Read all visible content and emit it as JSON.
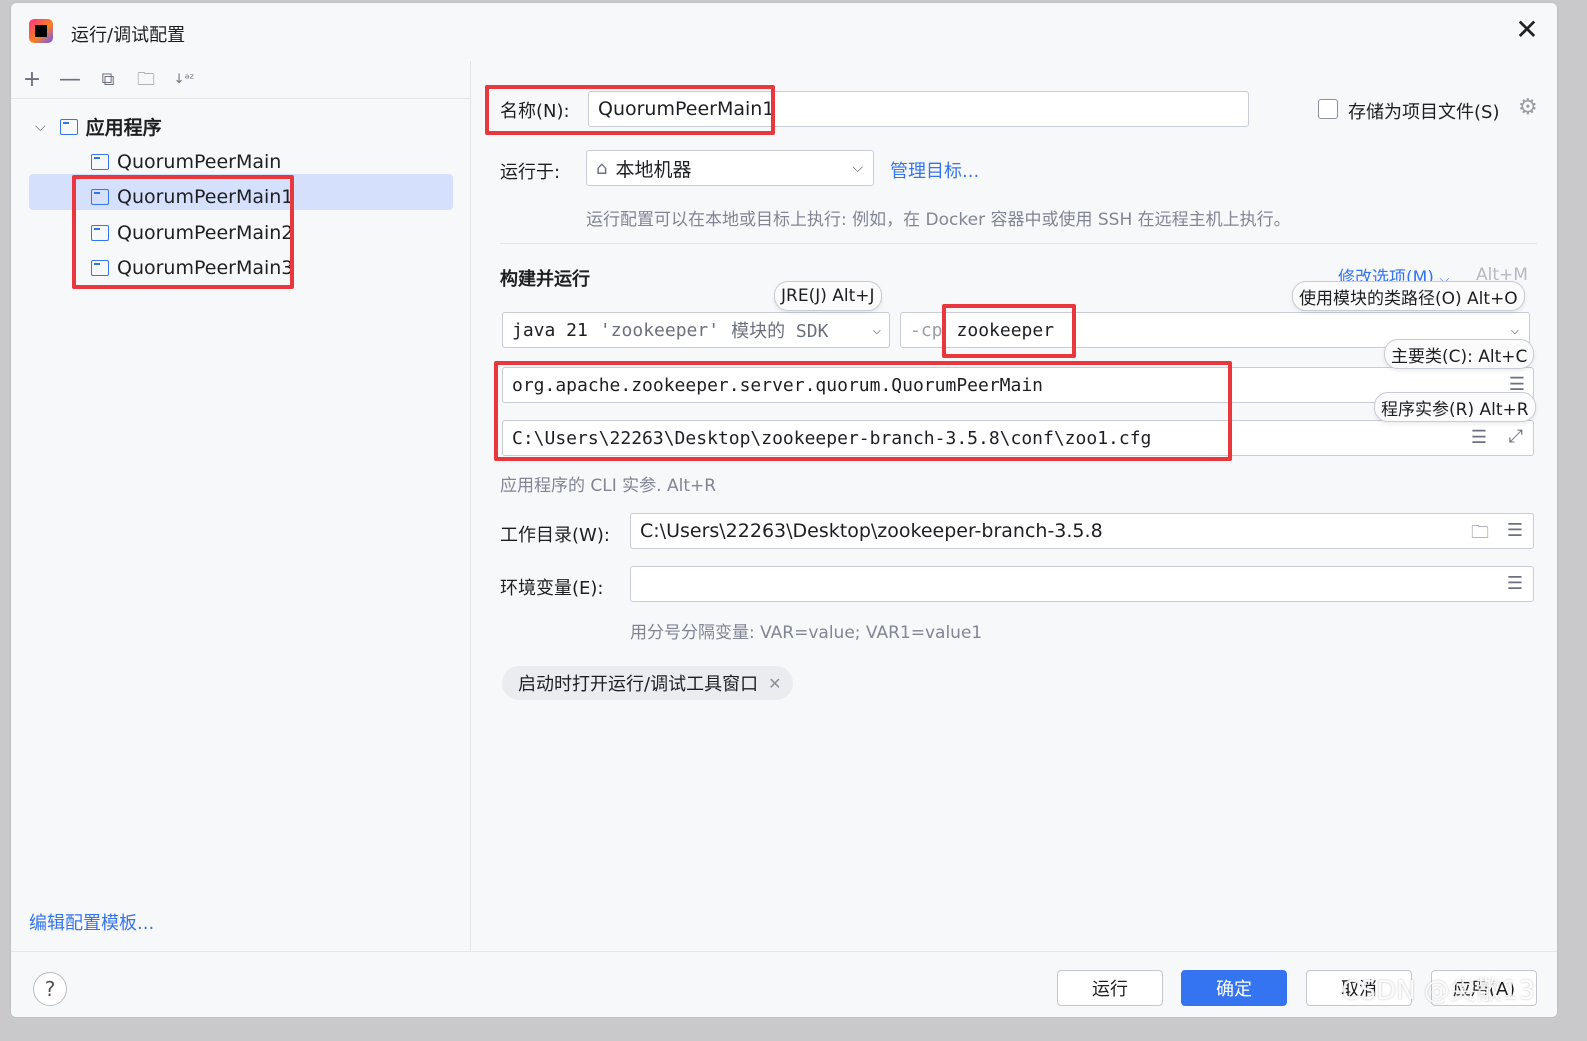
{
  "window": {
    "title": "运行/调试配置"
  },
  "toolbar": {
    "add": "+",
    "remove": "—",
    "copy": "⧉",
    "folder": "🗀",
    "sort": "↓ᵃᶻ"
  },
  "tree": {
    "group_label": "应用程序",
    "items": [
      "QuorumPeerMain",
      "QuorumPeerMain1",
      "QuorumPeerMain2",
      "QuorumPeerMain3"
    ],
    "selected": "QuorumPeerMain1"
  },
  "edit_templates": "编辑配置模板...",
  "form": {
    "name_label": "名称(N):",
    "name_value": "QuorumPeerMain1",
    "store_as_file_label": "存储为项目文件(S)",
    "run_on_label": "运行于:",
    "run_on_value": "本地机器",
    "manage_targets": "管理目标...",
    "run_on_hint": "运行配置可以在本地或目标上执行: 例如，在 Docker 容器中或使用 SSH 在远程主机上执行。",
    "build_run_title": "构建并运行",
    "modify_options": "修改选项(M)",
    "modify_shortcut": "Alt+M",
    "jre_tooltip": "JRE(J) Alt+J",
    "classpath_tooltip": "使用模块的类路径(O) Alt+O",
    "main_class_tooltip": "主要类(C): Alt+C",
    "program_args_tooltip": "程序实参(R) Alt+R",
    "sdk_java": "java 21",
    "sdk_module": "'zookeeper'",
    "sdk_suffix": "模块的 SDK",
    "cp_prefix": "-cp",
    "cp_value": "zookeeper",
    "main_class": "org.apache.zookeeper.server.quorum.QuorumPeerMain",
    "program_args": "C:\\Users\\22263\\Desktop\\zookeeper-branch-3.5.8\\conf\\zoo1.cfg",
    "program_args_hint": "应用程序的 CLI 实参. Alt+R",
    "workdir_label": "工作目录(W):",
    "workdir_value": "C:\\Users\\22263\\Desktop\\zookeeper-branch-3.5.8",
    "env_label": "环境变量(E):",
    "env_value": "",
    "env_hint": "用分号分隔变量: VAR=value; VAR1=value1",
    "chip_label": "启动时打开运行/调试工具窗口"
  },
  "footer": {
    "help": "?",
    "run": "运行",
    "ok": "确定",
    "cancel": "取消",
    "apply": "应用(A)"
  },
  "watermark": "CSDN @尖散13",
  "colors": {
    "accent": "#3574f0",
    "highlight": "#e8383d",
    "selection": "#d5e1fc"
  }
}
